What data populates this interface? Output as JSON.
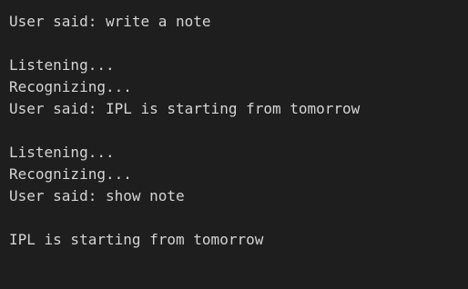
{
  "terminal": {
    "background": "#1e1e1e",
    "text_color": "#d4d4d4",
    "lines": [
      "User said: write a note",
      "",
      "Listening...",
      "Recognizing...",
      "User said: IPL is starting from tomorrow",
      "",
      "Listening...",
      "Recognizing...",
      "User said: show note",
      "",
      "IPL is starting from tomorrow"
    ]
  }
}
